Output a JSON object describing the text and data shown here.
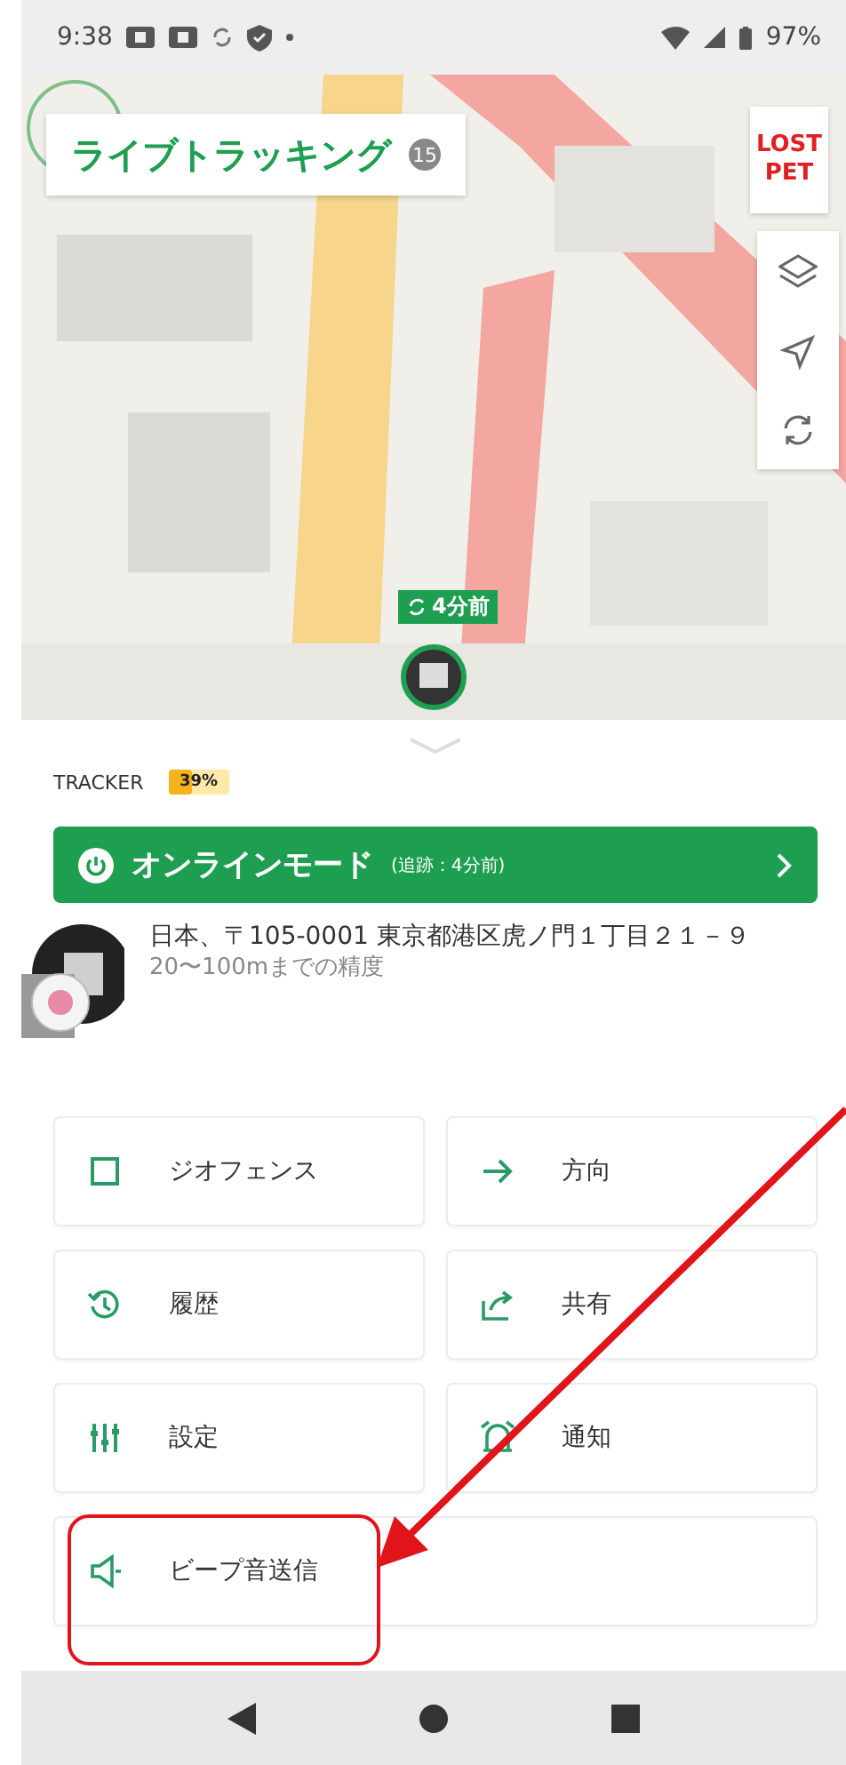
{
  "status_bar": {
    "time": "9:38",
    "battery": "97%"
  },
  "map": {
    "title": "ライブトラッキング",
    "count": "15",
    "lost_pet": "LOST PET",
    "update_chip": "4分前"
  },
  "tracker": {
    "label": "TRACKER",
    "battery": "39%",
    "battery_level": {
      "level": 0.39
    }
  },
  "online_button": {
    "label": "オンラインモード",
    "detail": "(追跡：4分前)"
  },
  "location": {
    "address": "日本、〒105-0001 東京都港区虎ノ門１丁目２１－９",
    "accuracy": "20〜100mまでの精度"
  },
  "actions": [
    {
      "label": "ジオフェンス"
    },
    {
      "label": "方向"
    },
    {
      "label": "履歴"
    },
    {
      "label": "共有"
    },
    {
      "label": "設定"
    },
    {
      "label": "通知"
    },
    {
      "label": "ビープ音送信"
    }
  ],
  "annotation": {
    "kind": "arrow-box"
  }
}
